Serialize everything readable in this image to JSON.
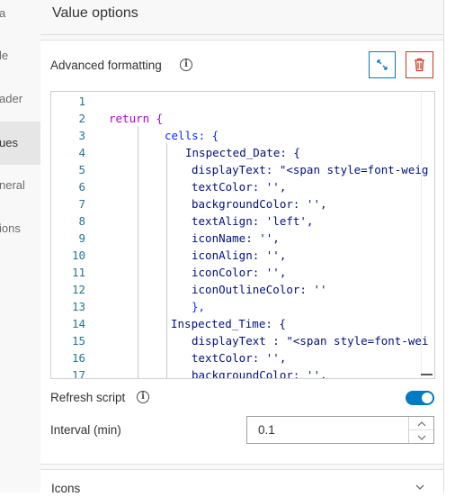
{
  "nav": {
    "items": [
      {
        "label": "a"
      },
      {
        "label": "le"
      },
      {
        "label": "ader"
      },
      {
        "label": "ues"
      },
      {
        "label": "neral"
      },
      {
        "label": "ions"
      }
    ]
  },
  "panel": {
    "title": "Value options",
    "advanced_label": "Advanced formatting",
    "refresh_label": "Refresh script",
    "refresh_enabled": true,
    "interval_label": "Interval (min)",
    "interval_value": "0.1",
    "icons_label": "Icons"
  },
  "colors": {
    "accent": "#007ac2",
    "danger": "#d83020"
  },
  "editor": {
    "line_numbers": [
      "1",
      "2",
      "3",
      "4",
      "5",
      "6",
      "7",
      "8",
      "9",
      "10",
      "11",
      "12",
      "13",
      "14",
      "15",
      "16",
      "17"
    ],
    "lines": [
      "",
      "return {",
      "cells: {",
      "Inspected_Date: {",
      "displayText: \"<span style=font-weig",
      "textColor: '',",
      "backgroundColor: '',",
      "textAlign: 'left',",
      "iconName: '',",
      "iconAlign: '',",
      "iconColor: '',",
      "iconOutlineColor: ''",
      "},",
      "Inspected_Time: {",
      "displayText : \"<span style=font-wei",
      "textColor: '',",
      "backgroundColor: '',"
    ]
  }
}
